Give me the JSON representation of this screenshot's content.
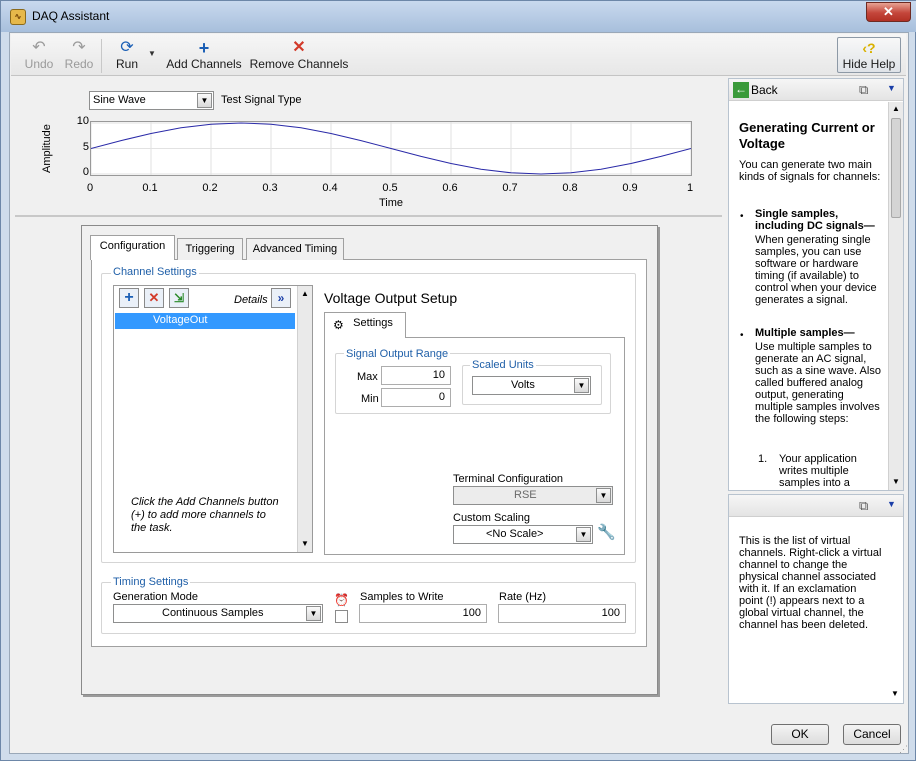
{
  "window": {
    "title": "DAQ Assistant",
    "close": "✕"
  },
  "toolbar": {
    "undo": "Undo",
    "redo": "Redo",
    "run": "Run",
    "add_channels": "Add Channels",
    "remove_channels": "Remove Channels",
    "hide_help": "Hide Help"
  },
  "signal": {
    "type_value": "Sine Wave",
    "type_label": "Test Signal Type"
  },
  "chart_data": {
    "type": "line",
    "xlabel": "Time",
    "ylabel": "Amplitude",
    "xlim": [
      0,
      1
    ],
    "ylim": [
      0,
      10
    ],
    "x_ticks": [
      "0",
      "0.1",
      "0.2",
      "0.3",
      "0.4",
      "0.5",
      "0.6",
      "0.7",
      "0.8",
      "0.9",
      "1"
    ],
    "y_ticks": [
      "0",
      "5",
      "10"
    ],
    "x": [
      0,
      0.05,
      0.1,
      0.15,
      0.2,
      0.25,
      0.3,
      0.35,
      0.4,
      0.45,
      0.5,
      0.55,
      0.6,
      0.65,
      0.7,
      0.75,
      0.8,
      0.85,
      0.9,
      0.95,
      1
    ],
    "y": [
      5,
      6.55,
      7.94,
      9.05,
      9.76,
      10,
      9.76,
      9.05,
      7.94,
      6.55,
      5,
      3.45,
      2.06,
      0.95,
      0.24,
      0,
      0.24,
      0.95,
      2.06,
      3.45,
      5
    ],
    "line_color": "#2a2aa8",
    "grid": true
  },
  "tabs": [
    "Configuration",
    "Triggering",
    "Advanced Timing"
  ],
  "channel_settings": {
    "label": "Channel Settings",
    "details": "Details",
    "channels": [
      "VoltageOut"
    ],
    "hint": "Click the Add Channels button (+) to add more channels to the task."
  },
  "voltage_setup": {
    "title": "Voltage Output Setup",
    "settings_tab": "Settings",
    "range_label": "Signal Output Range",
    "max_label": "Max",
    "max_value": "10",
    "min_label": "Min",
    "min_value": "0",
    "scaled_units_label": "Scaled Units",
    "scaled_units_value": "Volts",
    "terminal_label": "Terminal Configuration",
    "terminal_value": "RSE",
    "custom_scaling_label": "Custom Scaling",
    "custom_scaling_value": "<No Scale>"
  },
  "timing": {
    "label": "Timing Settings",
    "mode_label": "Generation Mode",
    "mode_value": "Continuous Samples",
    "samples_label": "Samples to Write",
    "samples_value": "100",
    "rate_label": "Rate (Hz)",
    "rate_value": "100"
  },
  "help": {
    "back": "Back",
    "heading": "Generating Current or Voltage",
    "intro": "You can generate two main kinds of signals for channels:",
    "b1_title": "Single samples, including DC signals—",
    "b1_text": "When generating single samples, you can use software or hardware timing (if available) to control when your device generates a signal.",
    "b2_title": "Multiple samples—",
    "b2_text": "Use multiple samples to generate an AC signal, such as a sine wave. Also called buffered analog output, generating multiple samples involves the following steps:",
    "step1_num": "1.",
    "step1_text": "Your application writes multiple samples into a",
    "context": "This is the list of virtual channels. Right-click a virtual channel to change the physical channel associated with it. If an exclamation point (!) appears next to a global virtual channel, the channel has been deleted."
  },
  "buttons": {
    "ok": "OK",
    "cancel": "Cancel"
  }
}
